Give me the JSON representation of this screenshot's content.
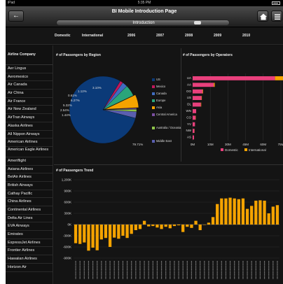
{
  "status_bar": {
    "carrier": "iPad",
    "time": "5:35 PM"
  },
  "header": {
    "title": "BI Mobile Introduction Page",
    "tab_label": "Introduction",
    "back_icon": "back-arrow-icon"
  },
  "filters": [
    "Domestic",
    "International",
    "2006",
    "2007",
    "2008",
    "2009",
    "2010"
  ],
  "sidebar": {
    "header": "Airline Company",
    "items": [
      "Aer Lingus",
      "Aeromexico",
      "Air Canada",
      "Air China",
      "Air France",
      "Air New Zealand",
      "AirTran Airways",
      "Alaska Airlines",
      "All Nippon Airways",
      "American Airlines",
      "American Eagle Airlines",
      "Ameriflight",
      "Asiana Airlines",
      "BelAir Airlines",
      "British Airways",
      "Cathay Pacific",
      "China Airlines",
      "Continental Airlines",
      "Delta Air Lines",
      "EVA Airways",
      "Emirates",
      "ExpressJet Airlines",
      "Frontier Airlines",
      "Hawaiian Airlines",
      "Horizon Air"
    ]
  },
  "colors": {
    "us": "#0b3a78",
    "mexico": "#c2185b",
    "canada": "#3f6cc0",
    "europe": "#2aa57a",
    "asia": "#f5a300",
    "central_america": "#7a4fa0",
    "australia": "#8fc64a",
    "middle_east": "#5a5fb0",
    "domestic": "#e8407c",
    "international": "#f5a300",
    "trend": "#f5a300"
  },
  "panels": {
    "region": {
      "title": "# of Passengers by Region"
    },
    "operators": {
      "title": "# of Passengers by Operators"
    },
    "trend": {
      "title": "# of Passengers Trend"
    }
  },
  "chart_data": [
    {
      "type": "pie",
      "title": "# of Passengers by Region",
      "categories": [
        "US",
        "Mexico",
        "Canada",
        "Europe",
        "Asia",
        "Central America",
        "Australia / Oceania",
        "Middle East"
      ],
      "values": [
        79.71,
        1.44,
        2.54,
        5.32,
        6.27,
        0.61,
        1.12,
        3.1
      ],
      "slice_labels": [
        "79.71%",
        "1.44%",
        "2.54%",
        "5.32%",
        "6.27%",
        "0.61%",
        "1.12%",
        "3.10%"
      ],
      "legend": [
        "US",
        "Mexico",
        "Canada",
        "Europe",
        "Asia",
        "Central America",
        "Australia / Oceania",
        "Middle East"
      ],
      "legend_position": "right"
    },
    {
      "type": "bar",
      "orientation": "horizontal",
      "stacked": true,
      "title": "# of Passengers by Operators",
      "categories": [
        "UA",
        "AA",
        "OO",
        "US",
        "DL",
        "WN",
        "CO",
        "YV",
        "NW",
        "AS"
      ],
      "series": [
        {
          "name": "Domestic",
          "values": [
            70,
            18,
            8.5,
            7.5,
            7,
            3,
            2.5,
            2,
            1.5,
            1.2
          ]
        },
        {
          "name": "International",
          "values": [
            8,
            0.8,
            0.4,
            0.3,
            0.3,
            0,
            0.2,
            0,
            0.1,
            0
          ]
        }
      ],
      "x_ticks": [
        "0M",
        "10M",
        "30M",
        "45M",
        "60M",
        "75M"
      ],
      "xlim": [
        0,
        75
      ],
      "legend_position": "bottom"
    },
    {
      "type": "bar",
      "title": "# of Passengers Trend",
      "y_ticks": [
        "1,200K",
        "900K",
        "600K",
        "300K",
        "0K",
        "-300K",
        "-600K",
        "-900K"
      ],
      "ylim": [
        -900,
        1200
      ],
      "values": [
        -500,
        -520,
        -480,
        -700,
        -620,
        -690,
        -400,
        -360,
        -600,
        -350,
        -380,
        -300,
        -360,
        -250,
        -150,
        -120,
        100,
        -50,
        -40,
        -80,
        -120,
        -60,
        -100,
        -40,
        -20,
        -200,
        -60,
        -90,
        100,
        -150,
        0,
        50,
        200,
        550,
        700,
        700,
        720,
        700,
        680,
        700,
        420,
        500,
        640,
        650,
        640,
        300,
        480,
        520
      ]
    }
  ]
}
